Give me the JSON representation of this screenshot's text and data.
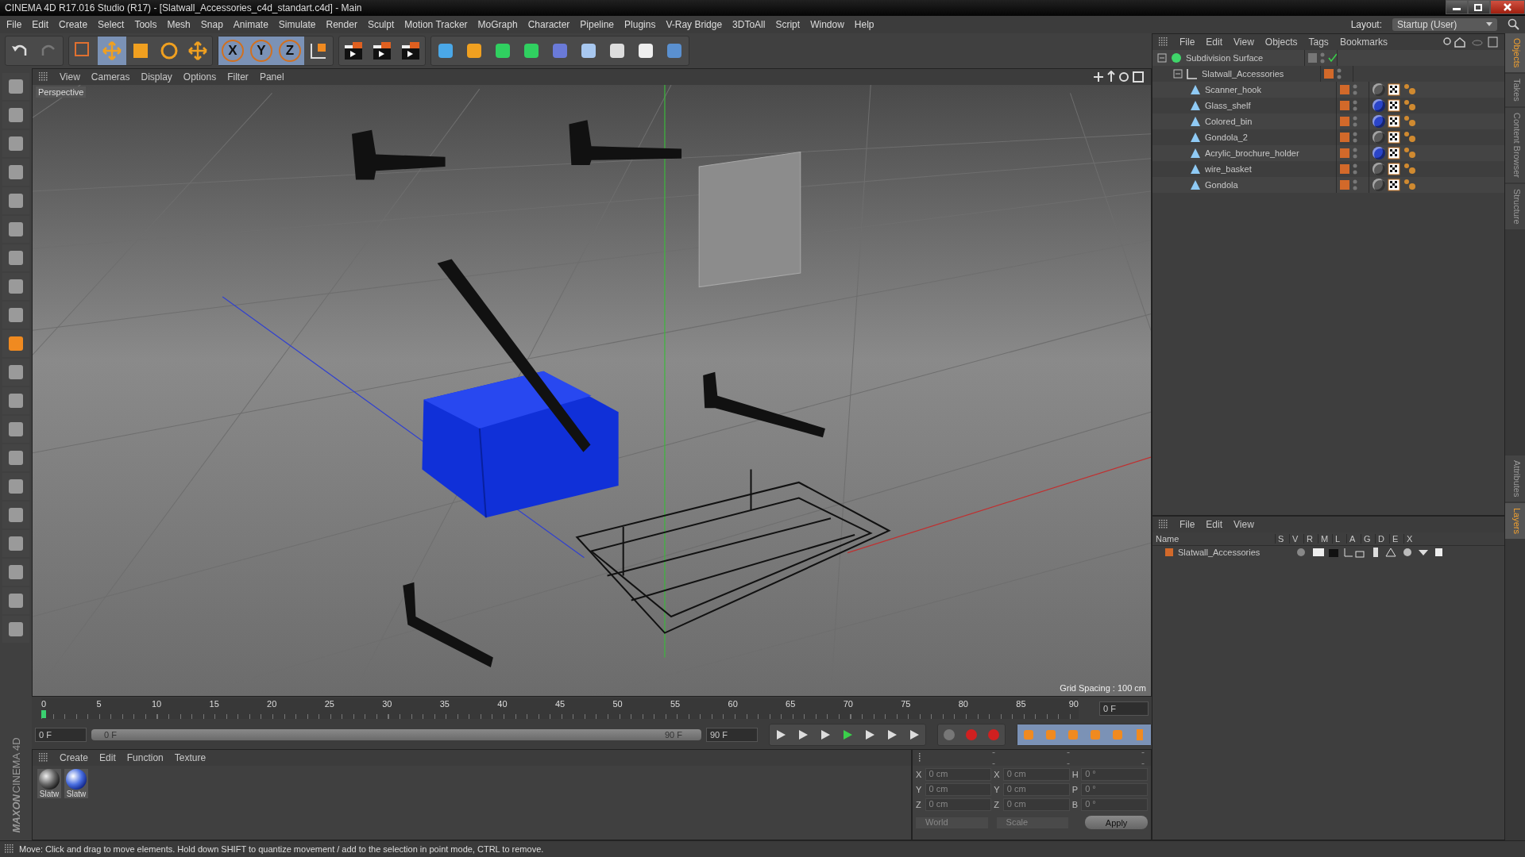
{
  "title_bar": {
    "title": "CINEMA 4D R17.016 Studio (R17) - [Slatwall_Accessories_c4d_standart.c4d] - Main"
  },
  "menu_bar": [
    "File",
    "Edit",
    "Create",
    "Select",
    "Tools",
    "Mesh",
    "Snap",
    "Animate",
    "Simulate",
    "Render",
    "Sculpt",
    "Motion Tracker",
    "MoGraph",
    "Character",
    "Pipeline",
    "Plugins",
    "V-Ray Bridge",
    "3DToAll",
    "Script",
    "Window",
    "Help"
  ],
  "layout": {
    "label": "Layout:",
    "value": "Startup (User)"
  },
  "toolbar": {
    "axis_buttons": [
      "X",
      "Y",
      "Z"
    ]
  },
  "viewport": {
    "menu": [
      "View",
      "Cameras",
      "Display",
      "Options",
      "Filter",
      "Panel"
    ],
    "camera_label": "Perspective",
    "grid_spacing": "Grid Spacing : 100 cm"
  },
  "timeline": {
    "ticks": [
      "0",
      "5",
      "10",
      "15",
      "20",
      "25",
      "30",
      "35",
      "40",
      "45",
      "50",
      "55",
      "60",
      "65",
      "70",
      "75",
      "80",
      "85",
      "90"
    ],
    "level": 0,
    "current_frame": "0 F",
    "start_field": "0 F",
    "range_slider": {
      "start": "0 F",
      "end": "90 F",
      "level": 1
    },
    "end_field": "90 F"
  },
  "material_manager": {
    "menu": [
      "Create",
      "Edit",
      "Function",
      "Texture"
    ],
    "materials": [
      {
        "name": "Slatw",
        "kind": "grey"
      },
      {
        "name": "Slatw",
        "kind": "blue"
      }
    ]
  },
  "logo": {
    "brand": "MAXON",
    "product": "CINEMA 4D"
  },
  "coordinates": {
    "headers": [
      "--",
      "--",
      "--"
    ],
    "rows": [
      {
        "axis": "X",
        "position": "0 cm",
        "size_axis": "X",
        "size": "0 cm",
        "rot_axis": "H",
        "rotation": "0 °"
      },
      {
        "axis": "Y",
        "position": "0 cm",
        "size_axis": "Y",
        "size": "0 cm",
        "rot_axis": "P",
        "rotation": "0 °"
      },
      {
        "axis": "Z",
        "position": "0 cm",
        "size_axis": "Z",
        "size": "0 cm",
        "rot_axis": "B",
        "rotation": "0 °"
      }
    ],
    "coord_system": "World",
    "mode": "Scale",
    "apply": "Apply"
  },
  "object_manager": {
    "menu": [
      "File",
      "Edit",
      "View",
      "Objects",
      "Tags",
      "Bookmarks"
    ],
    "objects": [
      {
        "name": "Subdivision Surface",
        "kind": "generator",
        "expanded": true,
        "enabled": true,
        "children": [
          {
            "name": "Slatwall_Accessories",
            "kind": "null",
            "expanded": true,
            "children": [
              {
                "name": "Scanner_hook",
                "kind": "polygon",
                "color": "#5a5a5a"
              },
              {
                "name": "Glass_shelf",
                "kind": "polygon",
                "color": "#2a44c8"
              },
              {
                "name": "Colored_bin",
                "kind": "polygon",
                "color": "#2a44c8"
              },
              {
                "name": "Gondola_2",
                "kind": "polygon",
                "color": "#5a5a5a"
              },
              {
                "name": "Acrylic_brochure_holder",
                "kind": "polygon",
                "color": "#2a44c8"
              },
              {
                "name": "wire_basket",
                "kind": "polygon",
                "color": "#5a5a5a"
              },
              {
                "name": "Gondola",
                "kind": "polygon",
                "color": "#5a5a5a"
              }
            ]
          }
        ]
      }
    ]
  },
  "layer_manager": {
    "menu": [
      "File",
      "Edit",
      "View"
    ],
    "columns": [
      "Name",
      "S",
      "V",
      "R",
      "M",
      "L",
      "A",
      "G",
      "D",
      "E",
      "X"
    ],
    "layers": [
      {
        "name": "Slatwall_Accessories",
        "color": "#d2692a"
      }
    ]
  },
  "side_tabs_top": [
    {
      "label": "Objects",
      "selected": true
    },
    {
      "label": "Takes",
      "selected": false
    },
    {
      "label": "Content Browser",
      "selected": false
    },
    {
      "label": "Structure",
      "selected": false
    }
  ],
  "side_tabs_bottom": [
    {
      "label": "Attributes",
      "selected": false
    },
    {
      "label": "Layers",
      "selected": true
    }
  ],
  "status_bar": {
    "text": "Move: Click and drag to move elements. Hold down SHIFT to quantize movement / add to the selection in point mode, CTRL to remove."
  }
}
